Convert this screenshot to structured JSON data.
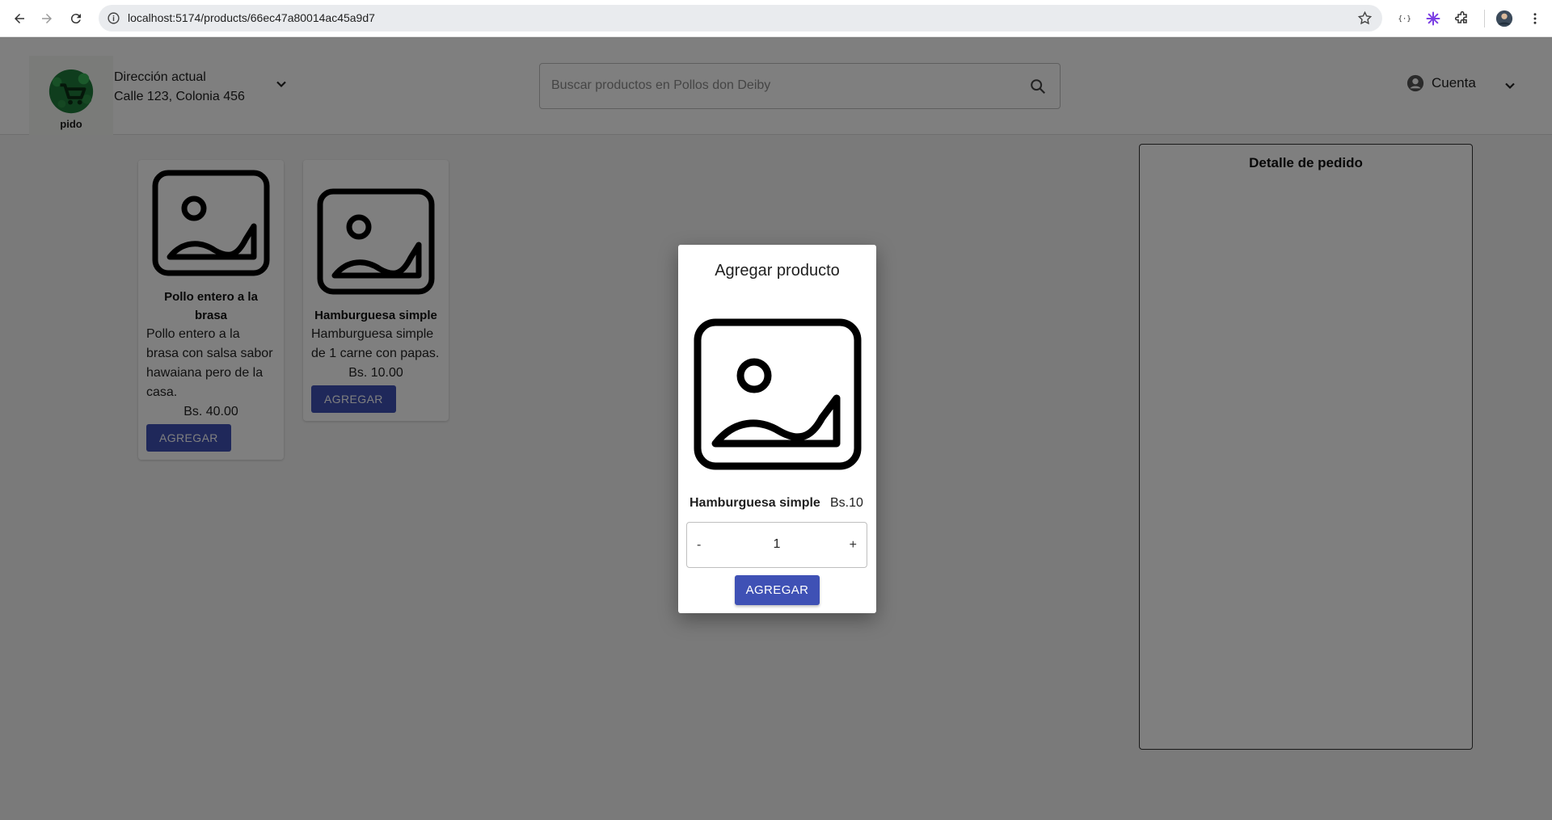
{
  "browser": {
    "url": "localhost:5174/products/66ec47a80014ac45a9d7"
  },
  "header": {
    "logo_text": "pido",
    "address_label": "Dirección actual",
    "address_value": "Calle 123, Colonia 456",
    "search_placeholder": "Buscar productos en Pollos don Deiby",
    "account_label": "Cuenta"
  },
  "products": [
    {
      "name": "Pollo entero a la brasa",
      "description": "Pollo entero a la brasa con salsa sabor hawaiana pero de la casa.",
      "price": "Bs. 40.00",
      "button": "AGREGAR"
    },
    {
      "name": "Hamburguesa simple",
      "description": "Hamburguesa simple de 1 carne con papas.",
      "price": "Bs. 10.00",
      "button": "AGREGAR"
    }
  ],
  "order": {
    "title": "Detalle de pedido"
  },
  "modal": {
    "title": "Agregar producto",
    "product_name": "Hamburguesa simple",
    "product_price": "Bs.10",
    "minus": "-",
    "quantity": "1",
    "plus": "+",
    "button": "AGREGAR"
  },
  "colors": {
    "primary": "#3f51b5",
    "overlay": "rgba(0,0,0,0.5)"
  }
}
